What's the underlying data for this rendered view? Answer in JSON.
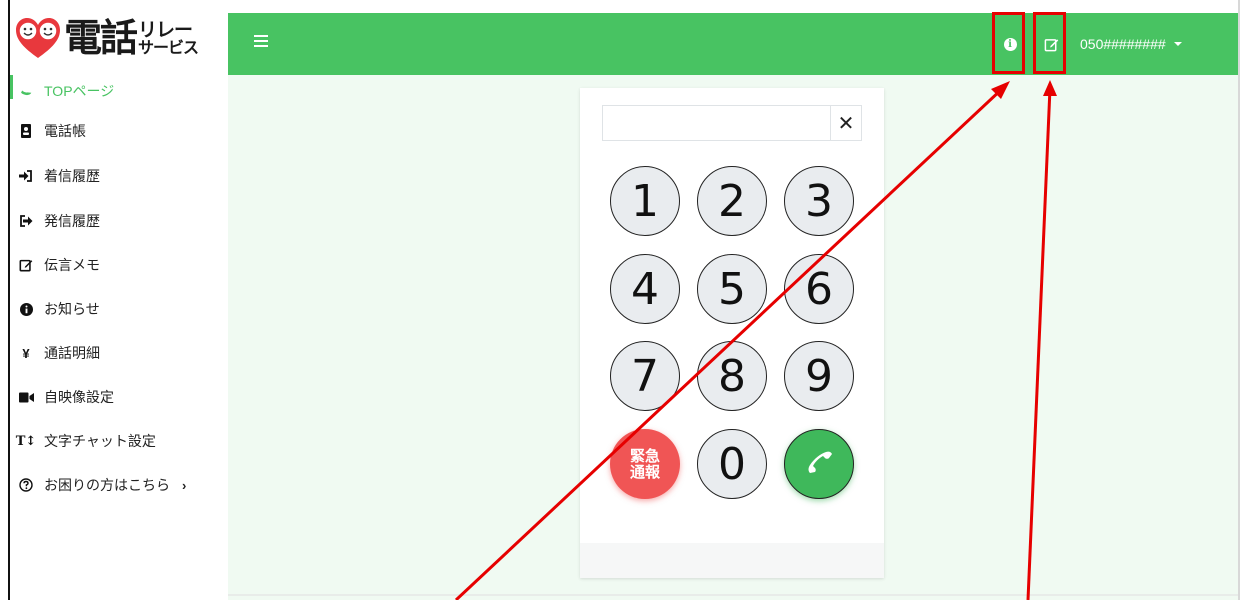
{
  "logo": {
    "main": "電話",
    "sub_line1": "リレー",
    "sub_line2": "サービス"
  },
  "header": {
    "account": "050########",
    "accent_color": "#48c362"
  },
  "sidebar": {
    "items": [
      {
        "label": "TOPページ",
        "icon": "phone-icon",
        "active": true
      },
      {
        "label": "電話帳",
        "icon": "address-book-icon"
      },
      {
        "label": "着信履歴",
        "icon": "sign-in-icon"
      },
      {
        "label": "発信履歴",
        "icon": "sign-out-icon"
      },
      {
        "label": "伝言メモ",
        "icon": "edit-icon"
      },
      {
        "label": "お知らせ",
        "icon": "info-icon"
      },
      {
        "label": "通話明細",
        "icon": "yen-icon"
      },
      {
        "label": "自映像設定",
        "icon": "video-icon"
      },
      {
        "label": "文字チャット設定",
        "icon": "text-height-icon"
      },
      {
        "label": "お困りの方はこちら",
        "icon": "question-circle-icon"
      }
    ]
  },
  "dialer": {
    "input_value": "",
    "clear_glyph": "✕",
    "keys": [
      "1",
      "2",
      "3",
      "4",
      "5",
      "6",
      "7",
      "8",
      "9",
      "0"
    ],
    "emergency_line1": "緊急",
    "emergency_line2": "通報",
    "emergency_color": "#f05555",
    "call_color": "#3fb85b"
  },
  "annotation_color": "#e60000"
}
